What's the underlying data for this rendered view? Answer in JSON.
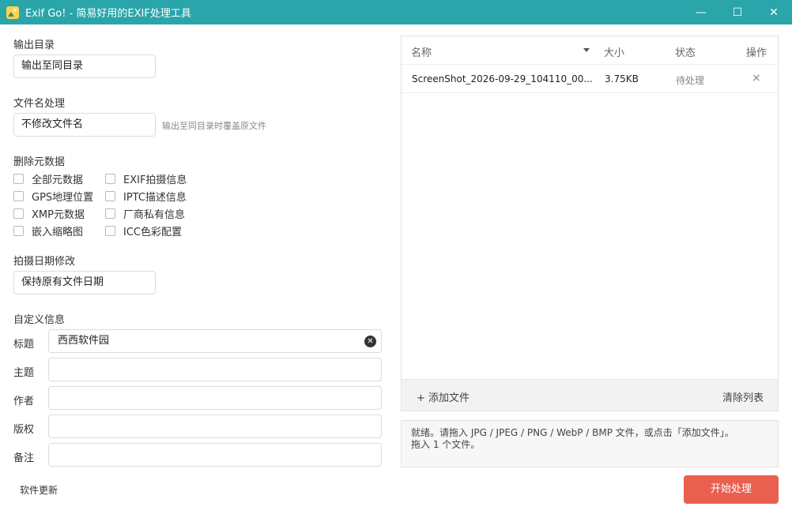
{
  "titlebar": {
    "title": "Exif Go! - 简易好用的EXIF处理工具",
    "minimize": "—",
    "maximize": "☐",
    "close": "✕"
  },
  "output": {
    "label": "输出目录",
    "value": "输出至同目录"
  },
  "filename": {
    "label": "文件名处理",
    "value": "不修改文件名",
    "hint": "输出至同目录时覆盖原文件"
  },
  "remove_meta": {
    "label": "删除元数据",
    "options": [
      {
        "label": "全部元数据",
        "checked": false
      },
      {
        "label": "EXIF拍摄信息",
        "checked": false
      },
      {
        "label": "GPS地理位置",
        "checked": false
      },
      {
        "label": "IPTC描述信息",
        "checked": false
      },
      {
        "label": "XMP元数据",
        "checked": false
      },
      {
        "label": "厂商私有信息",
        "checked": false
      },
      {
        "label": "嵌入缩略图",
        "checked": false
      },
      {
        "label": "ICC色彩配置",
        "checked": false
      }
    ]
  },
  "date": {
    "label": "拍摄日期修改",
    "value": "保持原有文件日期"
  },
  "custom": {
    "label": "自定义信息",
    "fields": [
      {
        "label": "标题",
        "value": "西西软件园"
      },
      {
        "label": "主题",
        "value": ""
      },
      {
        "label": "作者",
        "value": ""
      },
      {
        "label": "版权",
        "value": ""
      },
      {
        "label": "备注",
        "value": ""
      }
    ],
    "clear": "✕"
  },
  "update_link": "软件更新",
  "table": {
    "headers": {
      "name": "名称",
      "size": "大小",
      "status": "状态",
      "action": "操作"
    },
    "rows": [
      {
        "name": "ScreenShot_2026-09-29_104110_00...",
        "size": "3.75KB",
        "status": "待处理",
        "remove": "×"
      }
    ],
    "add_button": "+ 添加文件",
    "clear_button": "清除列表"
  },
  "status": {
    "line1": "就绪。请拖入 JPG / JPEG / PNG / WebP / BMP 文件，或点击「添加文件」。",
    "line2": "拖入 1 个文件。"
  },
  "start_button": "开始处理",
  "colors": {
    "titlebar": "#2aa5a9",
    "start_button": "#e95f50"
  }
}
